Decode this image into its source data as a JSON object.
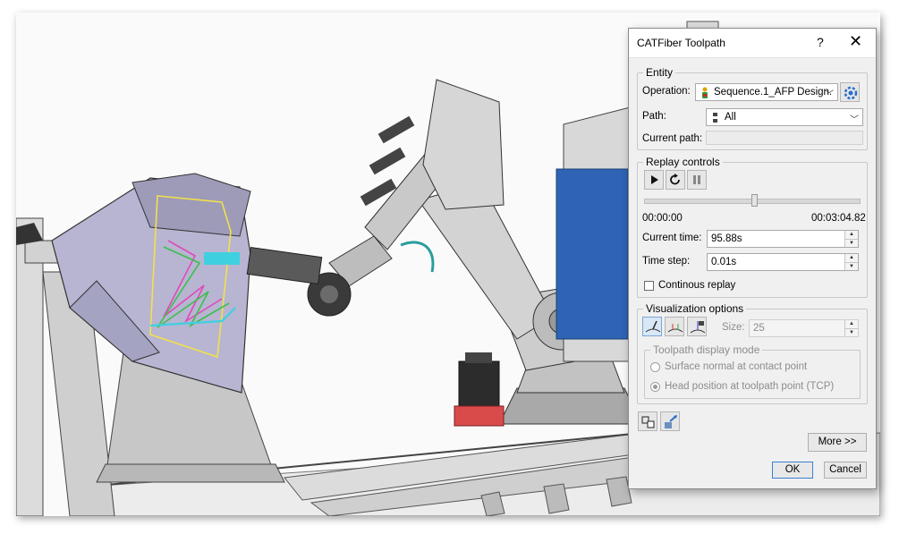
{
  "dialog": {
    "title": "CATFiber Toolpath",
    "help": "?",
    "close": "✕",
    "entity": {
      "legend": "Entity",
      "operation_label": "Operation:",
      "operation_value": "Sequence.1_AFP Design.",
      "path_label": "Path:",
      "path_value": "All",
      "current_path_label": "Current path:",
      "current_path_value": ""
    },
    "replay": {
      "legend": "Replay controls",
      "start_time": "00:00:00",
      "end_time": "00:03:04.82",
      "slider_position": 0.51,
      "current_time_label": "Current time:",
      "current_time_value": "95.88s",
      "time_step_label": "Time step:",
      "time_step_value": "0.01s",
      "continuous_label": "Continous replay",
      "continuous_checked": false
    },
    "visualization": {
      "legend": "Visualization options",
      "size_label": "Size:",
      "size_value": "25",
      "display_mode_legend": "Toolpath display mode",
      "mode_surface_normal": "Surface normal at contact point",
      "mode_head_position": "Head position at toolpath point (TCP)",
      "selected_mode": "head"
    },
    "more_label": "More >>",
    "ok_label": "OK",
    "cancel_label": "Cancel"
  },
  "colors": {
    "dialog_bg": "#f0f0f0",
    "robot_gray": "#c9c9c9",
    "cabinet_blue": "#2f63b5",
    "fixture_lavender": "#b7b5d2",
    "head_red": "#d94b4b",
    "toolpath_yellow": "#f2e14c",
    "toolpath_cyan": "#3fd0e0",
    "toolpath_magenta": "#e04ab8",
    "toolpath_green": "#3bbf4a"
  }
}
